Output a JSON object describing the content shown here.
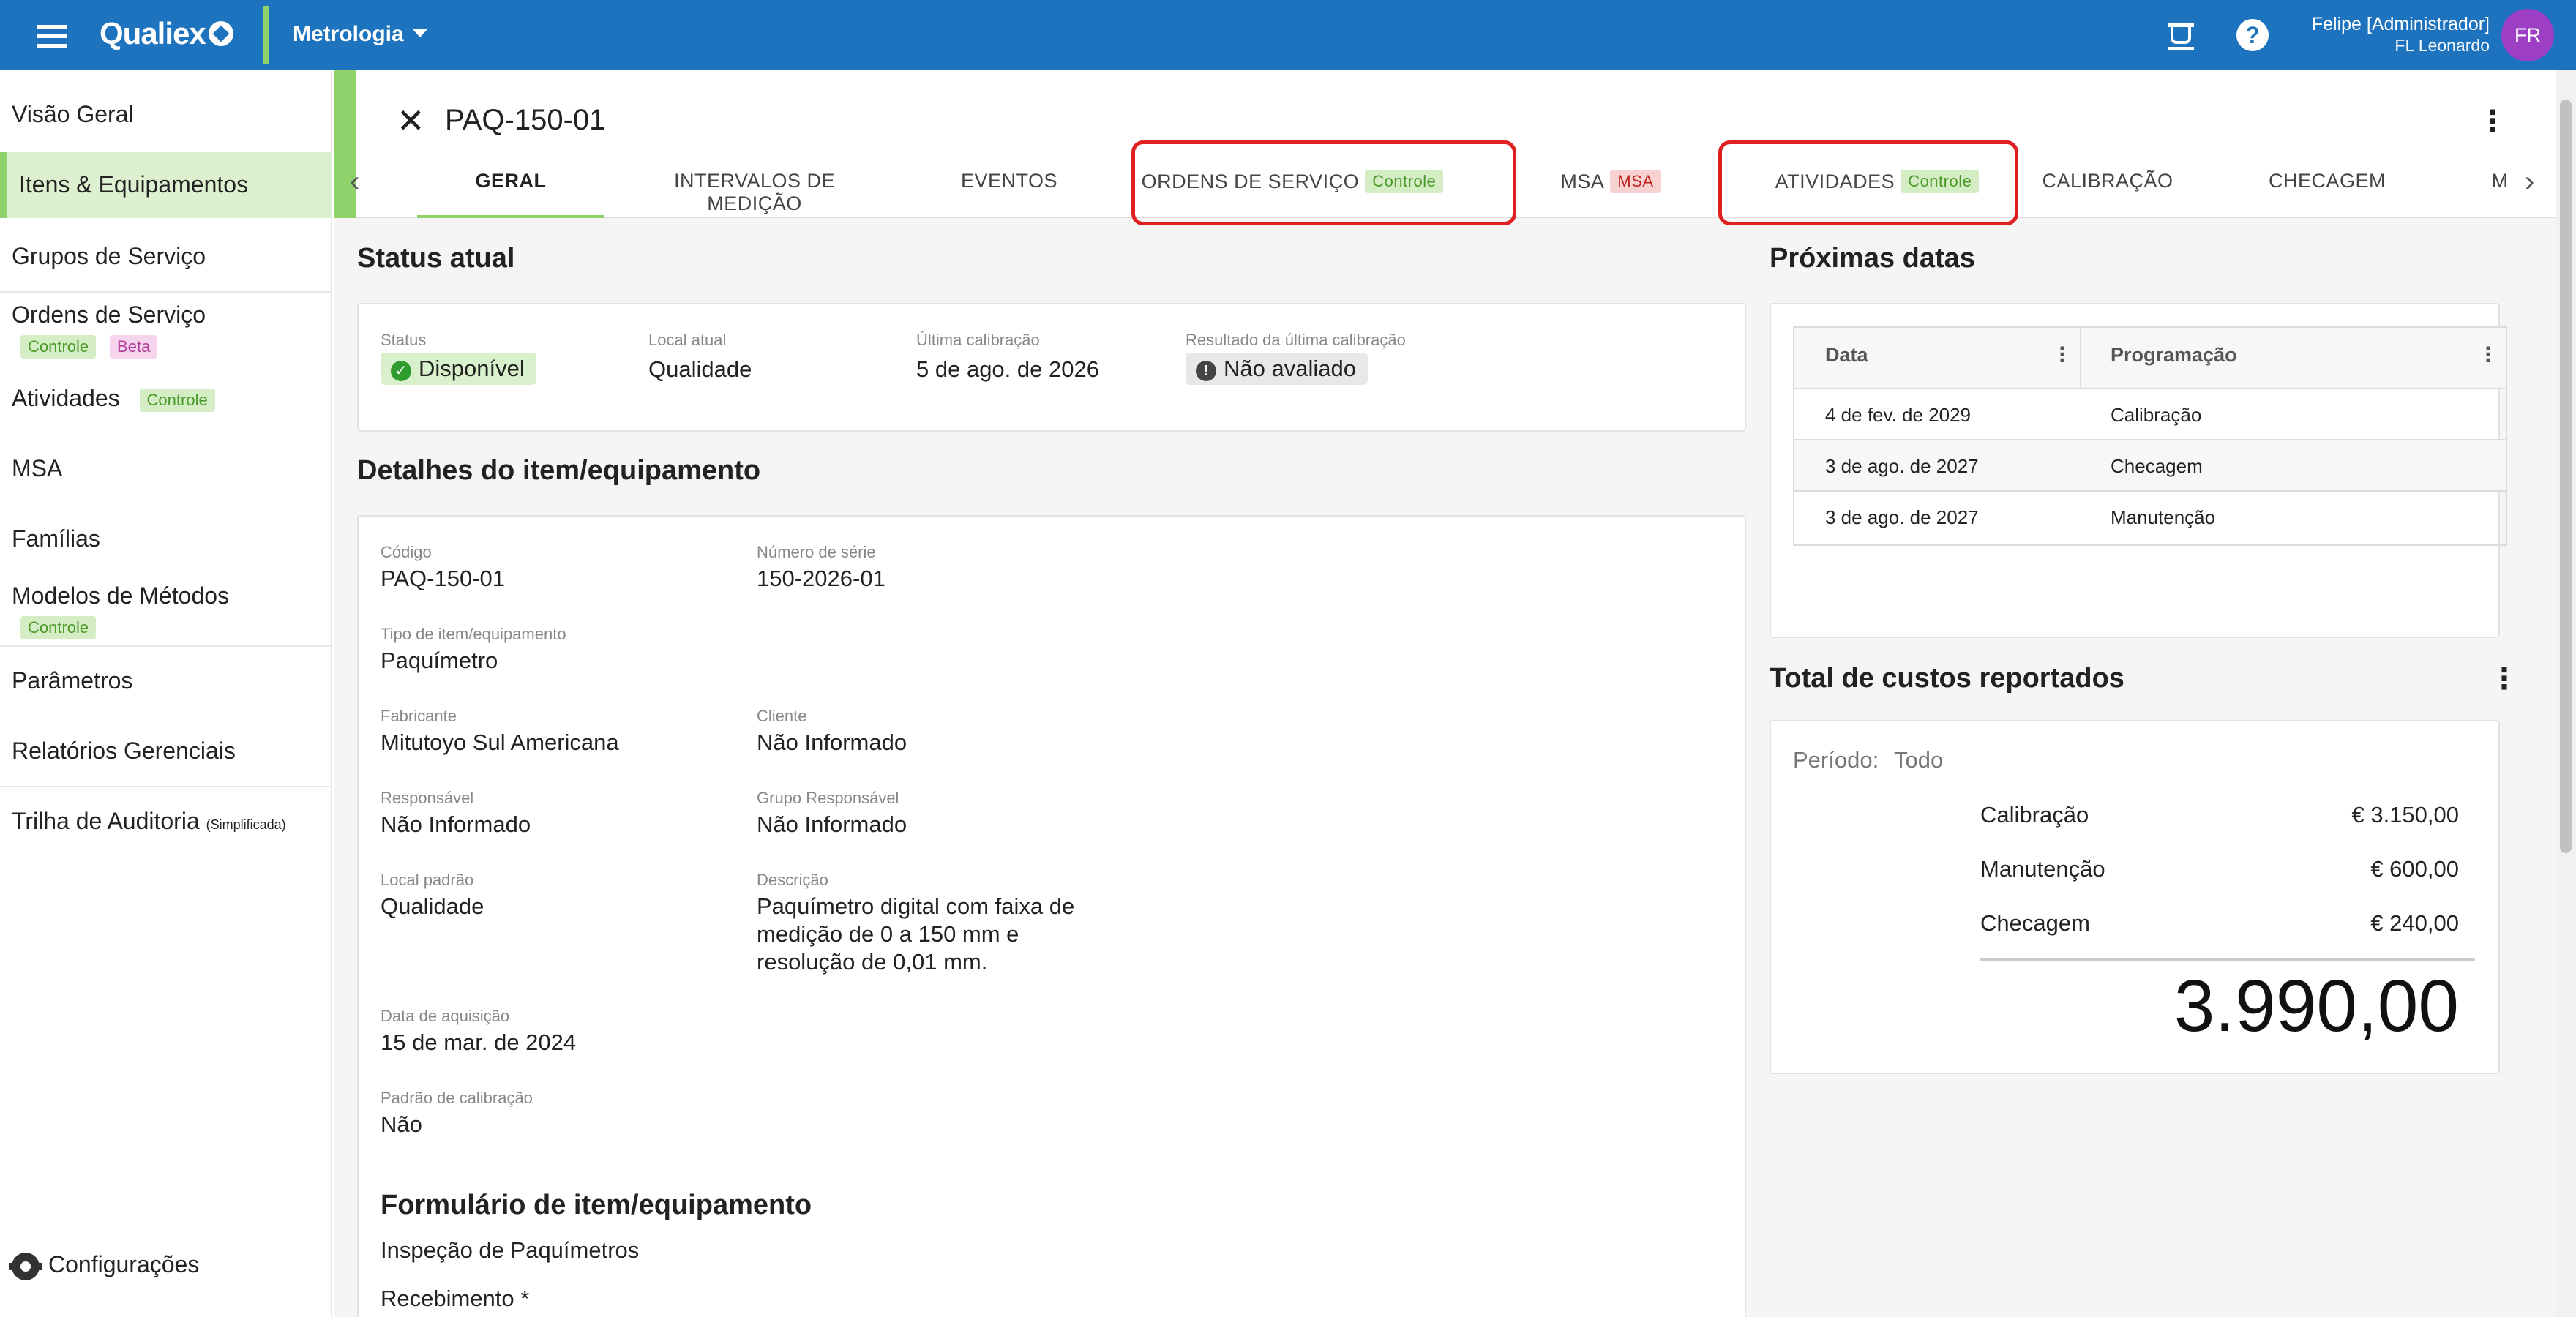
{
  "topbar": {
    "brand": "Qualiex",
    "module": "Metrologia",
    "user_name": "Felipe [Administrador]",
    "user_org": "FL Leonardo",
    "avatar_initials": "FR",
    "help_glyph": "?"
  },
  "sidebar": {
    "items": [
      {
        "label": "Visão Geral"
      },
      {
        "label": "Itens & Equipamentos"
      },
      {
        "label": "Grupos de Serviço"
      },
      {
        "label": "Ordens de Serviço",
        "badges": [
          "Controle",
          "Beta"
        ]
      },
      {
        "label": "Atividades",
        "badges": [
          "Controle"
        ]
      },
      {
        "label": "MSA"
      },
      {
        "label": "Famílias"
      },
      {
        "label": "Modelos de Métodos",
        "badges": [
          "Controle"
        ]
      },
      {
        "label": "Parâmetros"
      },
      {
        "label": "Relatórios Gerenciais"
      },
      {
        "label": "Trilha de Auditoria",
        "suffix": "(Simplificada)"
      }
    ],
    "settings_label": "Configurações"
  },
  "header": {
    "title": "PAQ-150-01",
    "tabs": [
      {
        "label": "GERAL"
      },
      {
        "label": "INTERVALOS DE MEDIÇÃO"
      },
      {
        "label": "EVENTOS"
      },
      {
        "label": "ORDENS DE SERVIÇO",
        "badge": "Controle"
      },
      {
        "label": "MSA",
        "badge": "MSA"
      },
      {
        "label": "ATIVIDADES",
        "badge": "Controle"
      },
      {
        "label": "CALIBRAÇÃO"
      },
      {
        "label": "CHECAGEM"
      },
      {
        "label": "M"
      }
    ]
  },
  "status": {
    "section_title": "Status atual",
    "status_label": "Status",
    "status_value": "Disponível",
    "local_label": "Local atual",
    "local_value": "Qualidade",
    "last_cal_label": "Última calibração",
    "last_cal_value": "5 de ago. de 2026",
    "result_label": "Resultado da última calibração",
    "result_value": "Não avaliado"
  },
  "details": {
    "section_title": "Detalhes do item/equipamento",
    "fields": {
      "codigo": {
        "label": "Código",
        "value": "PAQ-150-01"
      },
      "serie": {
        "label": "Número de série",
        "value": "150-2026-01"
      },
      "tipo": {
        "label": "Tipo de item/equipamento",
        "value": "Paquímetro"
      },
      "fabricante": {
        "label": "Fabricante",
        "value": "Mitutoyo Sul Americana"
      },
      "cliente": {
        "label": "Cliente",
        "value": "Não Informado"
      },
      "responsavel": {
        "label": "Responsável",
        "value": "Não Informado"
      },
      "grupo": {
        "label": "Grupo Responsável",
        "value": "Não Informado"
      },
      "local_padrao": {
        "label": "Local padrão",
        "value": "Qualidade"
      },
      "descricao": {
        "label": "Descrição",
        "lines": [
          "Paquímetro digital com faixa de",
          "medição de 0 a 150 mm e",
          "resolução de 0,01 mm."
        ]
      },
      "aquisicao": {
        "label": "Data de aquisição",
        "value": "15 de mar. de 2024"
      },
      "padrao_cal": {
        "label": "Padrão de calibração",
        "value": "Não"
      }
    },
    "form_title": "Formulário de item/equipamento",
    "form_name": "Inspeção de Paquímetros",
    "form_field": "Recebimento *"
  },
  "next_dates": {
    "section_title": "Próximas datas",
    "columns": [
      "Data",
      "Programação"
    ],
    "rows": [
      [
        "4 de fev. de 2029",
        "Calibração"
      ],
      [
        "3 de ago. de 2027",
        "Checagem"
      ],
      [
        "3 de ago. de 2027",
        "Manutenção"
      ]
    ]
  },
  "costs": {
    "section_title": "Total de custos reportados",
    "period_label": "Período:",
    "period_value": "Todo",
    "items": [
      {
        "label": "Calibração",
        "value": "€ 3.150,00"
      },
      {
        "label": "Manutenção",
        "value": "€ 600,00"
      },
      {
        "label": "Checagem",
        "value": "€ 240,00"
      }
    ],
    "total": "3.990,00"
  },
  "colors": {
    "topbar": "#1e73be",
    "accent_green": "#8fd16a",
    "highlight_red": "#e02020"
  }
}
